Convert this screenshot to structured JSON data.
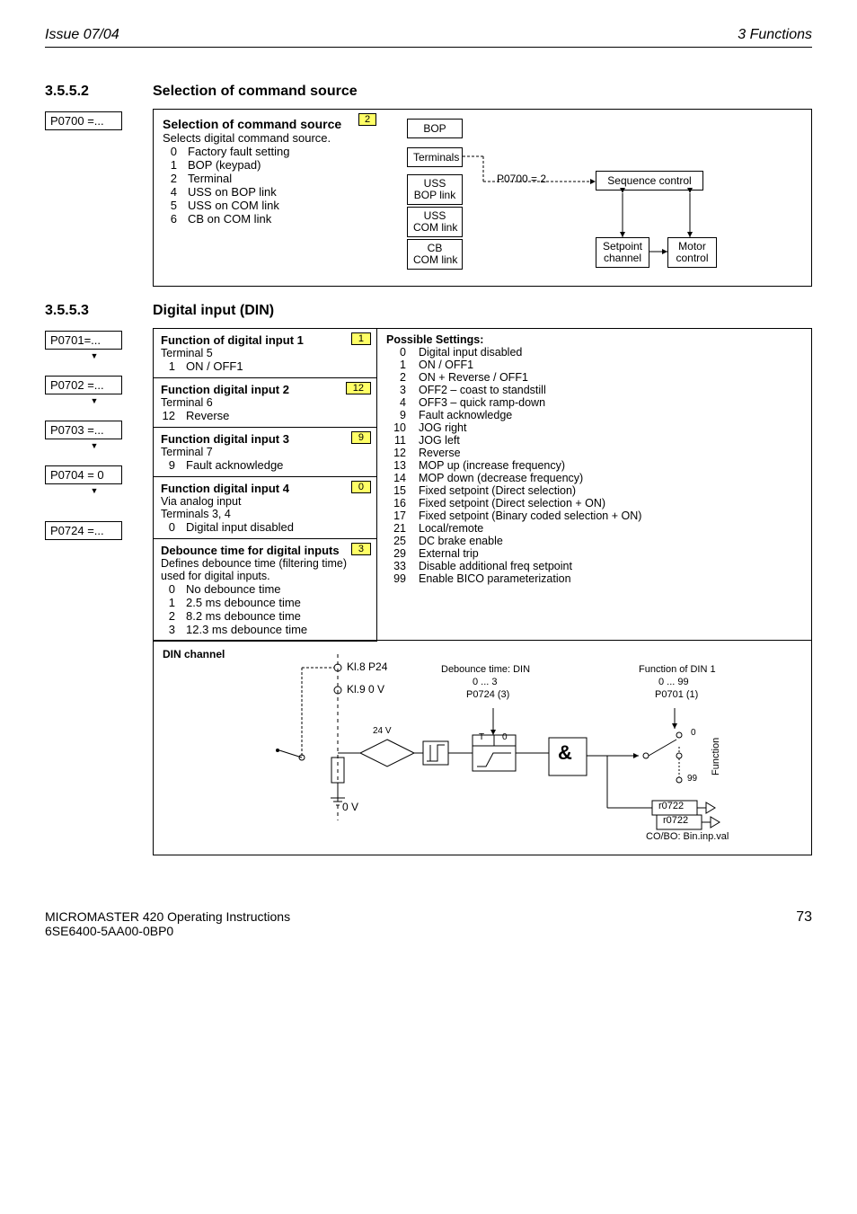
{
  "header": {
    "left": "Issue 07/04",
    "right": "3 Functions"
  },
  "sec1": {
    "num": "3.5.5.2",
    "title": "Selection of command source",
    "param": "P0700 =...",
    "badge": "2",
    "block_title": "Selection of command source",
    "block_sub": "Selects digital command source.",
    "opts": [
      {
        "n": "0",
        "t": "Factory fault setting"
      },
      {
        "n": "1",
        "t": "BOP (keypad)"
      },
      {
        "n": "2",
        "t": "Terminal"
      },
      {
        "n": "4",
        "t": "USS on BOP link"
      },
      {
        "n": "5",
        "t": "USS on COM link"
      },
      {
        "n": "6",
        "t": "CB on COM link"
      }
    ],
    "diag": {
      "bop": "BOP",
      "terminals": "Terminals",
      "uss_bop": "USS\nBOP link",
      "uss_com": "USS\nCOM link",
      "cb_com": "CB\nCOM link",
      "p0700": "P0700 = 2",
      "seq": "Sequence control",
      "setpoint": "Setpoint\nchannel",
      "motor": "Motor\ncontrol"
    }
  },
  "sec2": {
    "num": "3.5.5.3",
    "title": "Digital input (DIN)",
    "params": [
      {
        "p": "P0701=...",
        "badge": "1",
        "title": "Function of digital input 1",
        "l1": "Terminal 5",
        "opt": {
          "n": "1",
          "t": "ON / OFF1"
        }
      },
      {
        "p": "P0702 =...",
        "badge": "12",
        "title": "Function digital input 2",
        "l1": "Terminal 6",
        "opt": {
          "n": "12",
          "t": "Reverse"
        }
      },
      {
        "p": "P0703 =...",
        "badge": "9",
        "title": "Function digital input 3",
        "l1": "Terminal 7",
        "opt": {
          "n": "9",
          "t": "Fault acknowledge"
        }
      },
      {
        "p": "P0704 = 0",
        "badge": "0",
        "title": "Function digital input 4",
        "l1": "Via analog input",
        "l2": "Terminals 3, 4",
        "opt": {
          "n": "0",
          "t": "Digital input disabled"
        }
      },
      {
        "p": "P0724 =...",
        "badge": "3",
        "title": "Debounce time for digital inputs",
        "l1": "Defines debounce time (filtering time) used for digital inputs.",
        "opts": [
          {
            "n": "0",
            "t": "No debounce time"
          },
          {
            "n": "1",
            "t": "2.5 ms debounce time"
          },
          {
            "n": "2",
            "t": "8.2 ms debounce time"
          },
          {
            "n": "3",
            "t": "12.3 ms debounce time"
          }
        ]
      }
    ],
    "settings_title": "Possible Settings:",
    "settings": [
      {
        "n": "0",
        "t": "Digital input disabled"
      },
      {
        "n": "1",
        "t": "ON / OFF1"
      },
      {
        "n": "2",
        "t": "ON + Reverse / OFF1"
      },
      {
        "n": "3",
        "t": "OFF2 – coast to standstill"
      },
      {
        "n": "4",
        "t": "OFF3 – quick ramp-down"
      },
      {
        "n": "9",
        "t": "Fault acknowledge"
      },
      {
        "n": "10",
        "t": "JOG right"
      },
      {
        "n": "11",
        "t": "JOG left"
      },
      {
        "n": "12",
        "t": "Reverse"
      },
      {
        "n": "13",
        "t": "MOP up (increase frequency)"
      },
      {
        "n": "14",
        "t": "MOP down (decrease frequency)"
      },
      {
        "n": "15",
        "t": "Fixed setpoint (Direct selection)"
      },
      {
        "n": "16",
        "t": "Fixed setpoint (Direct selection + ON)"
      },
      {
        "n": "17",
        "t": "Fixed setpoint (Binary coded selection + ON)"
      },
      {
        "n": "21",
        "t": "Local/remote"
      },
      {
        "n": "25",
        "t": "DC brake enable"
      },
      {
        "n": "29",
        "t": "External trip"
      },
      {
        "n": "33",
        "t": "Disable additional freq setpoint"
      },
      {
        "n": "99",
        "t": "Enable BICO parameterization"
      }
    ],
    "din_channel": {
      "title": "DIN channel",
      "kl8": "Kl.8  P24",
      "kl9": "Kl.9  0 V",
      "deb_t": "Debounce time: DIN",
      "deb_r": "0 ... 3",
      "deb_p": "P0724 (3)",
      "fn_t": "Function of DIN 1",
      "fn_r": "0 ... 99",
      "fn_p": "P0701 (1)",
      "v24": "24 V",
      "v0": "0 V",
      "t": "T",
      "z": "0",
      "and": "&",
      "func": "Function",
      "zero": "0",
      "n99": "99",
      "r0722a": "r0722",
      "r0722b": "r0722",
      "cobo": "CO/BO: Bin.inp.val"
    }
  },
  "footer": {
    "l1": "MICROMASTER 420    Operating Instructions",
    "l2": "6SE6400-5AA00-0BP0",
    "page": "73"
  }
}
